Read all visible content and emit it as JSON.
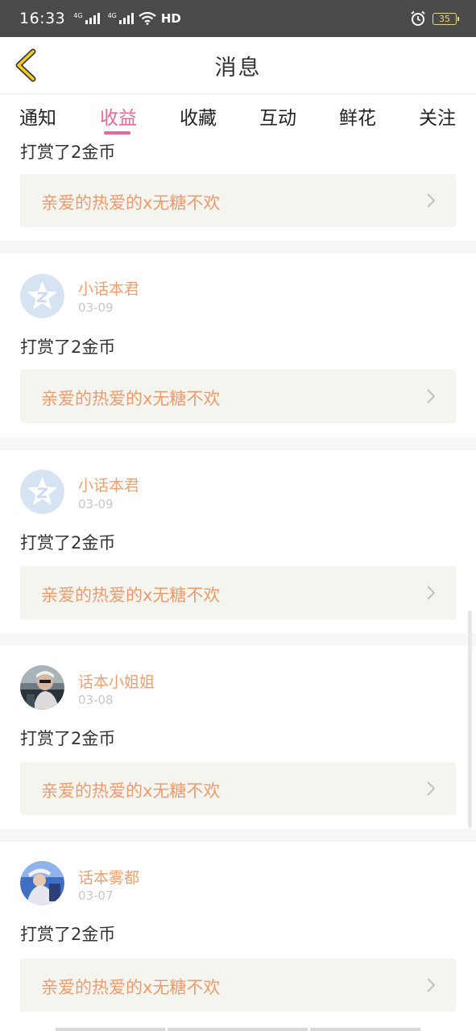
{
  "status_bar": {
    "time": "16:33",
    "signal_label": "4G",
    "hd_label": "HD",
    "battery": "35"
  },
  "header": {
    "title": "消息"
  },
  "tabs": [
    {
      "label": "通知",
      "active": false
    },
    {
      "label": "收益",
      "active": true
    },
    {
      "label": "收藏",
      "active": false
    },
    {
      "label": "互动",
      "active": false
    },
    {
      "label": "鲜花",
      "active": false
    },
    {
      "label": "关注",
      "active": false
    }
  ],
  "items": [
    {
      "message": "打赏了2金币",
      "link_text": "亲爱的热爱的x无糖不欢"
    },
    {
      "username": "小话本君",
      "date": "03-09",
      "avatar": "default-star-avatar",
      "message": "打赏了2金币",
      "link_text": "亲爱的热爱的x无糖不欢"
    },
    {
      "username": "小话本君",
      "date": "03-09",
      "avatar": "default-star-avatar",
      "message": "打赏了2金币",
      "link_text": "亲爱的热爱的x无糖不欢"
    },
    {
      "username": "话本小姐姐",
      "date": "03-08",
      "avatar": "photo-avatar",
      "message": "打赏了2金币",
      "link_text": "亲爱的热爱的x无糖不欢"
    },
    {
      "username": "话本雾都",
      "date": "03-07",
      "avatar": "photo-avatar",
      "message": "打赏了2金币",
      "link_text": "亲爱的热爱的x无糖不欢"
    }
  ],
  "colors": {
    "accent": "#e76a99",
    "username": "#f0a070",
    "link_text": "#ef9a6e",
    "link_bg": "#f5f5ef",
    "status_bar_bg": "#4a4a4a"
  },
  "icons": [
    "back-chevron-icon",
    "chevron-right-icon",
    "alarm-icon",
    "wifi-icon",
    "signal-icon",
    "battery-icon"
  ]
}
